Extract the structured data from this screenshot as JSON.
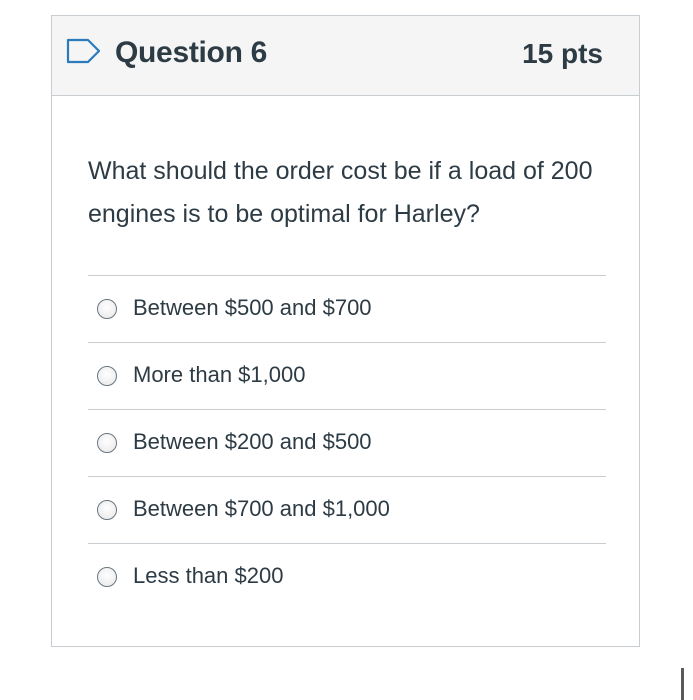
{
  "question": {
    "title": "Question 6",
    "points": "15 pts",
    "text": "What should the order cost be if a load of 200 engines is to be optimal for Harley?",
    "flag_icon": "flag-outline-icon"
  },
  "answers": [
    {
      "label": "Between $500 and $700",
      "selected": false
    },
    {
      "label": "More than $1,000",
      "selected": false
    },
    {
      "label": "Between $200 and $500",
      "selected": false
    },
    {
      "label": "Between $700 and $1,000",
      "selected": false
    },
    {
      "label": "Less than $200",
      "selected": false
    }
  ],
  "colors": {
    "text": "#2d3b45",
    "header_bg": "#f5f5f5",
    "border": "#c7cdd1",
    "flag": "#2b7abc"
  }
}
